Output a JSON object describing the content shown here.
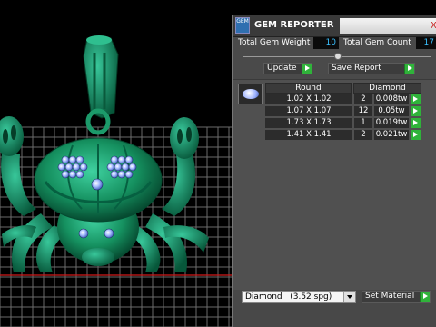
{
  "panel": {
    "title": "GEM REPORTER",
    "close_mark": "X",
    "app_icon_text": "GEM"
  },
  "stats": {
    "weight_label": "Total Gem Weight",
    "weight_value": "10",
    "count_label": "Total Gem Count",
    "count_value": "17"
  },
  "actions": {
    "update_label": "Update",
    "save_label": "Save Report"
  },
  "table": {
    "shape_header": "Round",
    "material_header": "Diamond",
    "rows": [
      {
        "size": "1.02 X 1.02",
        "count": "2",
        "weight": "0.008tw"
      },
      {
        "size": "1.07 X 1.07",
        "count": "12",
        "weight": "0.05tw"
      },
      {
        "size": "1.73 X 1.73",
        "count": "1",
        "weight": "0.019tw"
      },
      {
        "size": "1.41 X 1.41",
        "count": "2",
        "weight": "0.021tw"
      }
    ]
  },
  "material": {
    "selected": "Diamond",
    "density": "(3.52 spg)",
    "set_label": "Set Material"
  },
  "colors": {
    "model": "#1c8f6a",
    "grid": "#6a6a6a",
    "panel": "#4a4a4a",
    "value_text": "#3ac0ff",
    "go_button": "#2fb33a"
  }
}
